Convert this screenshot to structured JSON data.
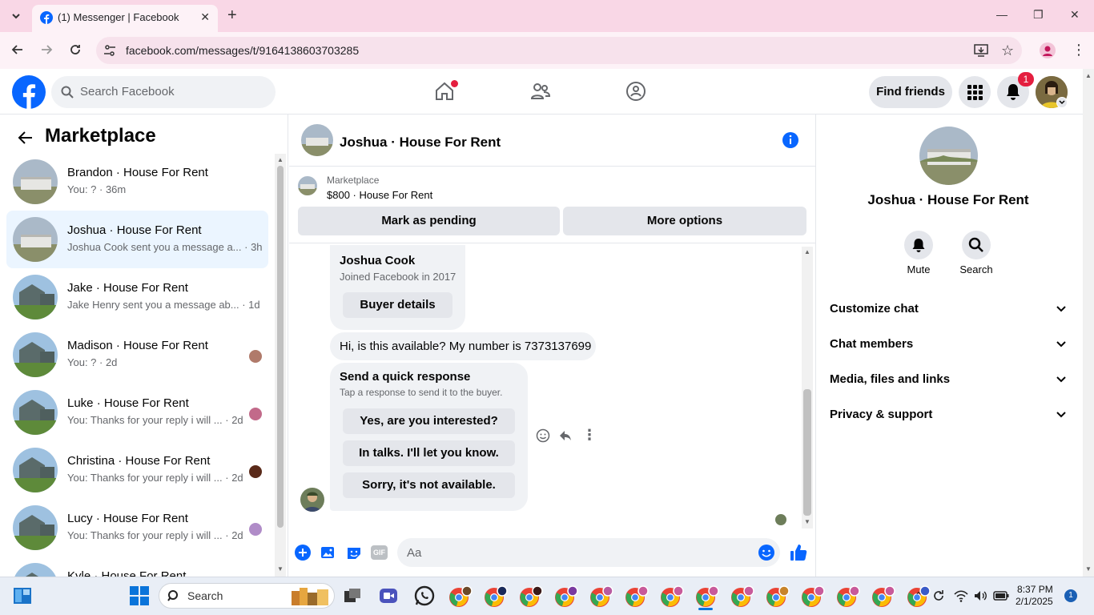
{
  "browser": {
    "tab_title": "(1) Messenger | Facebook",
    "url": "facebook.com/messages/t/9164138603703285"
  },
  "header": {
    "search_placeholder": "Search Facebook",
    "find_friends": "Find friends",
    "notification_count": "1"
  },
  "sidebar": {
    "title": "Marketplace",
    "conversations": [
      {
        "name": "Brandon · House For Rent",
        "preview": "You: ? · 36m"
      },
      {
        "name": "Joshua · House For Rent",
        "preview": "Joshua Cook sent you a message a... · 3h"
      },
      {
        "name": "Jake · House For Rent",
        "preview": "Jake Henry sent you a message ab... · 1d"
      },
      {
        "name": "Madison · House For Rent",
        "preview": "You: ? · 2d"
      },
      {
        "name": "Luke · House For Rent",
        "preview": "You: Thanks for your reply i will ... · 2d"
      },
      {
        "name": "Christina · House For Rent",
        "preview": "You: Thanks for your reply i will ... · 2d"
      },
      {
        "name": "Lucy · House For Rent",
        "preview": "You: Thanks for your reply i will ... · 2d"
      },
      {
        "name": "Kyle · House For Rent",
        "preview": ""
      }
    ]
  },
  "chat": {
    "title": "Joshua · House For Rent",
    "listing_label": "Marketplace",
    "listing_price": "$800 · House For Rent",
    "mark_pending": "Mark as pending",
    "more_options": "More options",
    "buyer_name": "Joshua Cook",
    "buyer_joined": "Joined Facebook in 2017",
    "buyer_details": "Buyer details",
    "message": "Hi, is this available? My number is 7373137699",
    "quick_title": "Send a quick response",
    "quick_sub": "Tap a response to send it to the buyer.",
    "quick_responses": [
      "Yes, are you interested?",
      "In talks. I'll let you know.",
      "Sorry, it's not available."
    ],
    "composer_placeholder": "Aa"
  },
  "details": {
    "name": "Joshua · House For Rent",
    "mute": "Mute",
    "search": "Search",
    "sections": [
      "Customize chat",
      "Chat members",
      "Media, files and links",
      "Privacy & support"
    ]
  },
  "taskbar": {
    "search_placeholder": "Search",
    "time": "8:37 PM",
    "date": "2/1/2025",
    "notification_count": "1"
  },
  "colors": {
    "fb_blue": "#0866ff",
    "tab_pink": "#f9d7e6"
  }
}
